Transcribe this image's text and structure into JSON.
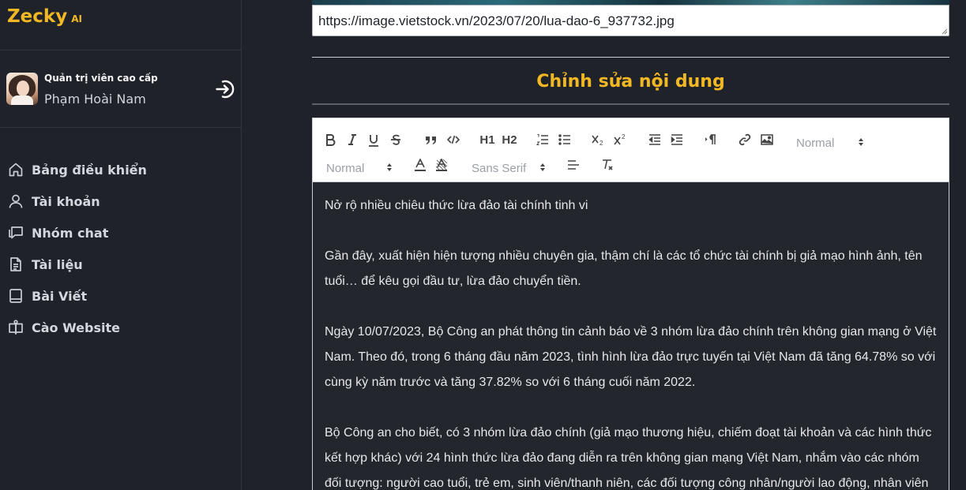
{
  "brand": {
    "name": "Zecky",
    "suffix": "AI"
  },
  "user": {
    "role": "Quản trị viên cao cấp",
    "name": "Phạm Hoài Nam"
  },
  "nav": [
    {
      "label": "Bảng điều khiển",
      "icon": "home-icon"
    },
    {
      "label": "Tài khoản",
      "icon": "user-icon"
    },
    {
      "label": "Nhóm chat",
      "icon": "chat-icon"
    },
    {
      "label": "Tài liệu",
      "icon": "document-icon"
    },
    {
      "label": "Bài Viết",
      "icon": "article-icon"
    },
    {
      "label": "Cào Website",
      "icon": "book-open-icon"
    }
  ],
  "image_url": {
    "value": "https://image.vietstock.vn/2023/07/20/lua-dao-6_937732.jpg"
  },
  "section": {
    "title": "Chỉnh sửa nội dung"
  },
  "toolbar": {
    "header_select": "Normal",
    "size_select": "Normal",
    "font_select": "Sans Serif",
    "h1": "H1",
    "h2": "H2"
  },
  "content": {
    "paragraphs": [
      "Nở rộ nhiều chiêu thức lừa đảo tài chính tinh vi",
      "",
      "Gần đây, xuất hiện hiện tượng nhiều chuyên gia, thậm chí là các tổ chức tài chính bị giả mạo hình ảnh, tên tuổi… để kêu gọi đầu tư, lừa đảo chuyển tiền.",
      "",
      "Ngày 10/07/2023, Bộ Công an phát thông tin cảnh báo về 3 nhóm lừa đảo chính trên không gian mạng ở Việt Nam. Theo đó, trong 6 tháng đầu năm 2023, tình hình lừa đảo trực tuyến tại Việt Nam đã tăng 64.78% so với cùng kỳ năm trước và tăng 37.82% so với 6 tháng cuối năm 2022.",
      "",
      "Bộ Công an cho biết, có 3 nhóm lừa đảo chính (giả mạo thương hiệu, chiếm đoạt tài khoản và các hình thức kết hợp khác) với 24 hình thức lừa đảo đang diễn ra trên không gian mạng Việt Nam, nhắm vào các nhóm đối tượng: người cao tuổi, trẻ em, sinh viên/thanh niên, các đối tượng công nhân/người lao động, nhân viên"
    ]
  },
  "colors": {
    "accent": "#f2b824",
    "background": "#1f2329",
    "editor_bg": "#23272d"
  }
}
